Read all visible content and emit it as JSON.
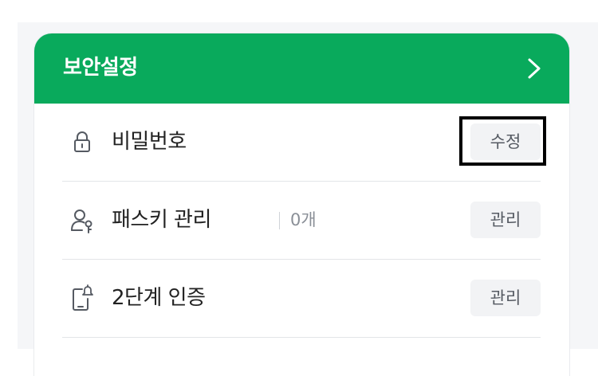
{
  "card": {
    "title": "보안설정"
  },
  "rows": [
    {
      "label": "비밀번호",
      "button": "수정",
      "icon": "lock-icon"
    },
    {
      "label": "패스키 관리",
      "count": "0개",
      "button": "관리",
      "icon": "passkey-user-icon"
    },
    {
      "label": "2단계 인증",
      "button": "관리",
      "icon": "phone-bell-icon"
    }
  ],
  "colors": {
    "accent": "#09aa5c",
    "button_bg": "#f2f3f5",
    "divider": "#e3e5e8"
  }
}
